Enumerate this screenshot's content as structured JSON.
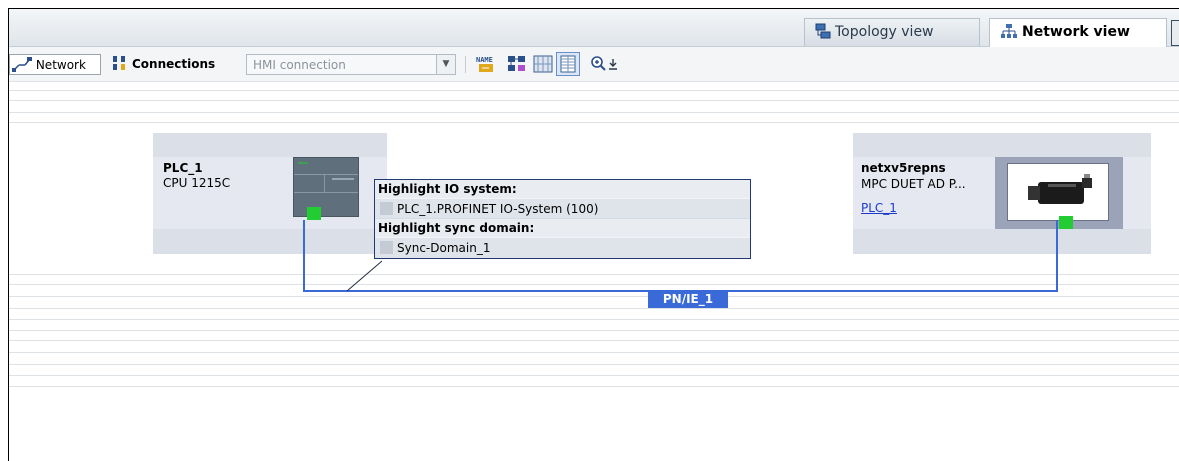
{
  "tabs": [
    {
      "label": "Topology view",
      "icon": "topology-view-icon",
      "active": false
    },
    {
      "label": "Network view",
      "icon": "network-view-icon",
      "active": true
    }
  ],
  "toolbar": {
    "network_label": "Network",
    "connections_label": "Connections",
    "connection_type_placeholder": "HMI connection"
  },
  "devices": [
    {
      "name": "PLC_1",
      "type": "CPU 1215C",
      "link": ""
    },
    {
      "name": "netxv5repns",
      "type": "MPC DUET AD P...",
      "link": "PLC_1"
    }
  ],
  "tooltip": {
    "io_heading": "Highlight IO system:",
    "io_item": "PLC_1.PROFINET IO-System (100)",
    "sync_heading": "Highlight sync domain:",
    "sync_item": "Sync-Domain_1"
  },
  "network": {
    "label": "PN/IE_1",
    "color": "#3a6ad8"
  },
  "colors": {
    "port": "#22cc33",
    "link_text": "#1a3cc8"
  }
}
